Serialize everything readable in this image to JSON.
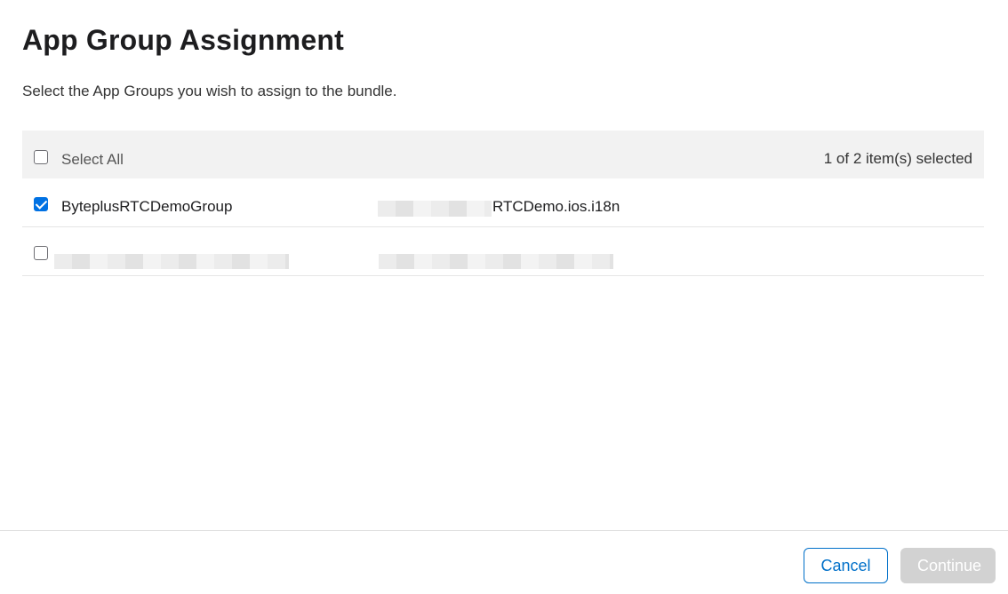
{
  "dialog": {
    "title": "App Group Assignment",
    "subtitle": "Select the App Groups you wish to assign to the bundle."
  },
  "table": {
    "select_all_label": "Select All",
    "select_all_checked": false,
    "selected_count": "1 of 2 item(s) selected",
    "rows": [
      {
        "name": "ByteplusRTCDemoGroup",
        "identifier_suffix": "RTCDemo.ios.i18n",
        "checked": true
      },
      {
        "name": "",
        "identifier_suffix": "",
        "checked": false
      }
    ]
  },
  "footer": {
    "cancel_label": "Cancel",
    "continue_label": "Continue",
    "continue_enabled": false
  },
  "colors": {
    "accent": "#0070c9",
    "checkbox_checked": "#0071e3",
    "header_background": "#f2f2f2",
    "disabled_button": "#d2d2d2"
  }
}
